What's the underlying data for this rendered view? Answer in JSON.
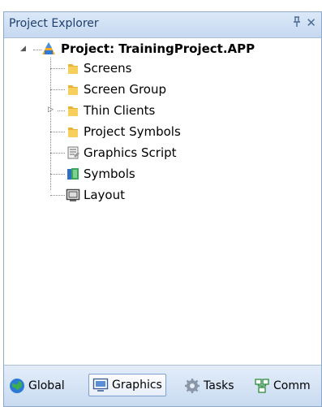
{
  "panel": {
    "title": "Project Explorer",
    "pin_glyph": "ฺ",
    "close_glyph": "✕"
  },
  "tree": {
    "root": {
      "label": "Project: TrainingProject.APP",
      "icon": "project-icon",
      "expanded": true
    },
    "children": [
      {
        "label": "Screens",
        "icon": "folder-icon"
      },
      {
        "label": "Screen Group",
        "icon": "folder-icon"
      },
      {
        "label": "Thin Clients",
        "icon": "folder-icon",
        "expandable": true
      },
      {
        "label": "Project Symbols",
        "icon": "folder-icon"
      },
      {
        "label": "Graphics Script",
        "icon": "script-icon"
      },
      {
        "label": "Symbols",
        "icon": "symbols-icon"
      },
      {
        "label": "Layout",
        "icon": "layout-icon"
      }
    ]
  },
  "tabs": [
    {
      "label": "Global",
      "icon": "globe-icon",
      "active": false
    },
    {
      "label": "Graphics",
      "icon": "graphics-icon",
      "active": true
    },
    {
      "label": "Tasks",
      "icon": "gear-icon",
      "active": false
    },
    {
      "label": "Comm",
      "icon": "comm-icon",
      "active": false
    }
  ]
}
